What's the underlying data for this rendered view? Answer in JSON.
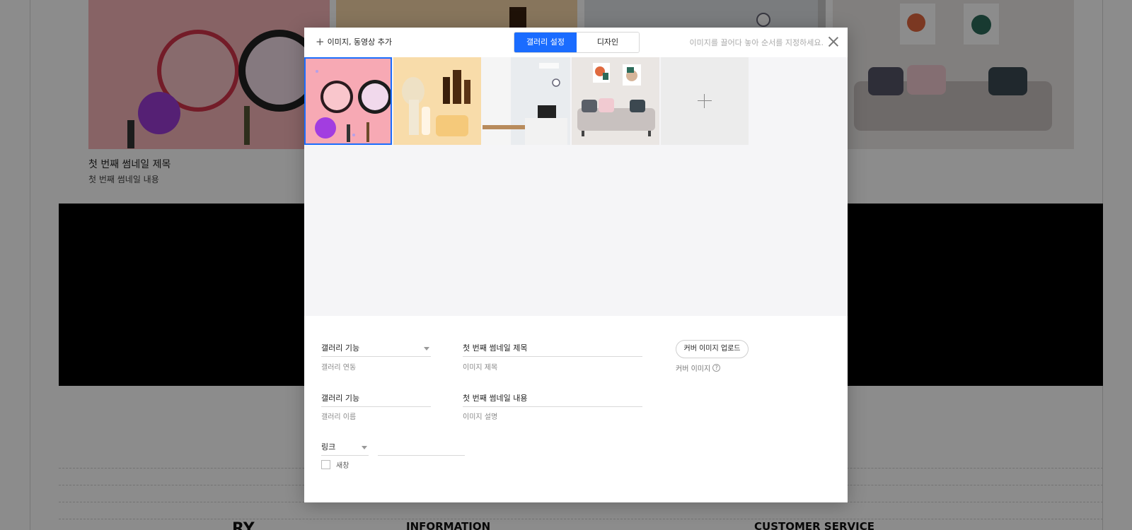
{
  "background": {
    "thumb_title": "첫 번째 썸네일 제목",
    "thumb_desc": "첫 번째 썸네일 내용",
    "footer_logo": "RY",
    "footer_info": "INFORMATION",
    "footer_cs": "CUSTOMER SERVICE"
  },
  "header": {
    "add_media_label": "이미지, 동영상 추가",
    "tabs": [
      {
        "label": "갤러리 설정",
        "active": true
      },
      {
        "label": "디자인",
        "active": false
      }
    ],
    "hint": "이미지를 끌어다 놓아 순서를 지정하세요."
  },
  "gallery": {
    "thumbnails": [
      {
        "icon": "cosmetics-photo",
        "selected": true
      },
      {
        "icon": "skincare-photo",
        "selected": false
      },
      {
        "icon": "kitchen-photo",
        "selected": false
      },
      {
        "icon": "sofa-photo",
        "selected": false
      }
    ]
  },
  "form": {
    "gallery_function": {
      "value": "갤러리 기능",
      "label": "갤러리 연동"
    },
    "gallery_name": {
      "value": "갤러리 기능",
      "label": "갤러리 이름"
    },
    "image_title": {
      "value": "첫 번째 썸네일 제목",
      "label": "이미지 제목"
    },
    "image_desc": {
      "value": "첫 번째 썸네일 내용",
      "label": "이미지 설명"
    },
    "cover_upload_label": "커버 이미지 업로드",
    "cover_image_label": "커버 이미지",
    "link": {
      "value": "링크",
      "url": ""
    },
    "new_window_label": "새창"
  },
  "colors": {
    "accent": "#1a6cff"
  }
}
